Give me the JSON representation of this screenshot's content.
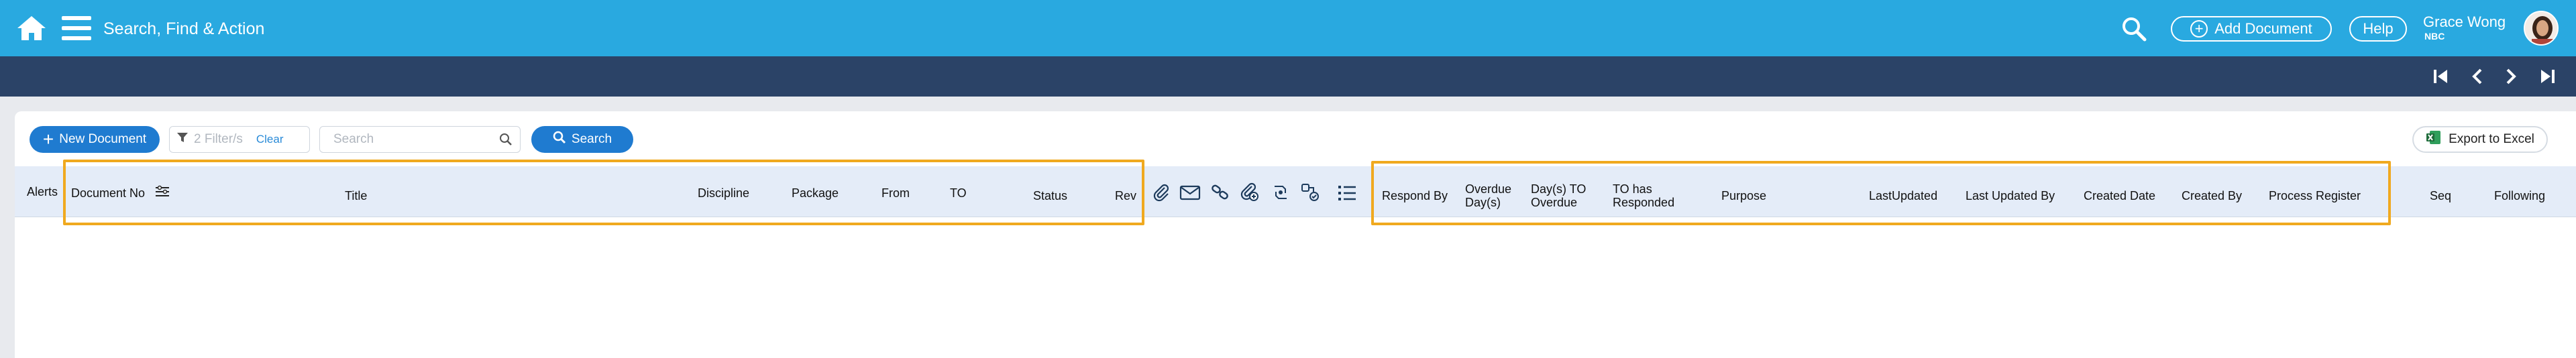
{
  "topbar": {
    "title": "Search, Find & Action",
    "add_document_label": "Add Document",
    "help_label": "Help",
    "user_name": "Grace Wong",
    "user_org": "NBC"
  },
  "toolbar": {
    "new_document_label": "New Document",
    "filter_text": "2 Filter/s",
    "clear_label": "Clear",
    "search_placeholder": "Search",
    "search_button_label": "Search",
    "export_label": "Export to Excel"
  },
  "columns": {
    "alerts": "Alerts",
    "document_no": "Document No",
    "title": "Title",
    "discipline": "Discipline",
    "package": "Package",
    "from": "From",
    "to": "TO",
    "status": "Status",
    "rev": "Rev",
    "respond_by": "Respond By",
    "overdue_days_1": "Overdue",
    "overdue_days_2": "Day(s)",
    "days_to_overdue_1": "Day(s) TO",
    "days_to_overdue_2": "Overdue",
    "to_has_responded_1": "TO has",
    "to_has_responded_2": "Responded",
    "purpose": "Purpose",
    "last_updated": "LastUpdated",
    "last_updated_by": "Last Updated By",
    "created_date": "Created Date",
    "created_by": "Created By",
    "process_register": "Process Register",
    "seq": "Seq",
    "following": "Following"
  },
  "colors": {
    "topbar": "#29a9e0",
    "navbar": "#2b4367",
    "primary_button": "#1f7bd0",
    "header_row": "#e4ecf8",
    "highlight": "#f0a91f"
  },
  "icons": [
    "home-icon",
    "menu-icon",
    "search-icon",
    "first-page-icon",
    "prev-page-icon",
    "next-page-icon",
    "last-page-icon",
    "filter-icon",
    "excel-icon",
    "attachment-icon",
    "mail-icon",
    "link-icon",
    "linked-attachment-icon",
    "transmittal-icon",
    "workflow-icon",
    "list-icon"
  ]
}
